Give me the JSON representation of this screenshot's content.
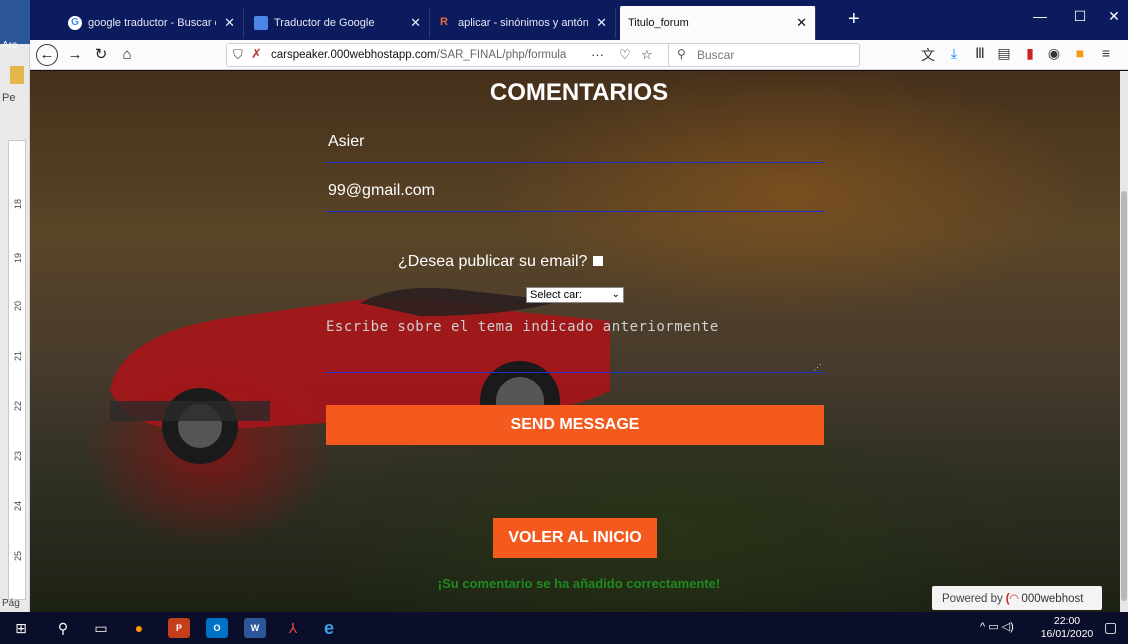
{
  "word": {
    "tab_fragment": "Arc",
    "side_label": "Pe",
    "page_fragment": "Pág",
    "ruler_numbers": [
      "18",
      "19",
      "20",
      "21",
      "22",
      "23",
      "24",
      "25"
    ]
  },
  "browser": {
    "tabs": [
      {
        "label": "google traductor - Buscar con",
        "favicon": "google-icon",
        "color": "#4285f4"
      },
      {
        "label": "Traductor de Google",
        "favicon": "translate-icon",
        "color": "#4a86e8"
      },
      {
        "label": "aplicar - sinónimos y antónimo",
        "favicon": "wordreference-icon",
        "color": "#c9472b"
      },
      {
        "label": "Titulo_forum",
        "favicon": "",
        "color": "",
        "active": true
      }
    ],
    "url_host": "carspeaker.000webhostapp.com",
    "url_path": "/SAR_FINAL/php/formula",
    "url_actions": "···",
    "search_placeholder": "Buscar"
  },
  "form": {
    "title": "COMENTARIOS",
    "name_value": "Asier",
    "email_value": "99@gmail.com",
    "publish_email_label": "¿Desea publicar su email?",
    "select_value": "Select car:",
    "message_placeholder": "Escribe sobre el tema indicado anteriormente",
    "send_label": "SEND MESSAGE",
    "home_label": "VOLER AL INICIO",
    "success_message": "¡Su comentario se ha añadido correctamente!"
  },
  "badge": {
    "prefix": "Powered by",
    "brand": "000webhost"
  },
  "taskbar": {
    "time": "22:00",
    "date": "16/01/2020"
  },
  "colors": {
    "accent": "#f45a1d",
    "underline": "#1c2fcc",
    "success": "#1f8a1f",
    "tabbar": "#0c1a5e"
  }
}
